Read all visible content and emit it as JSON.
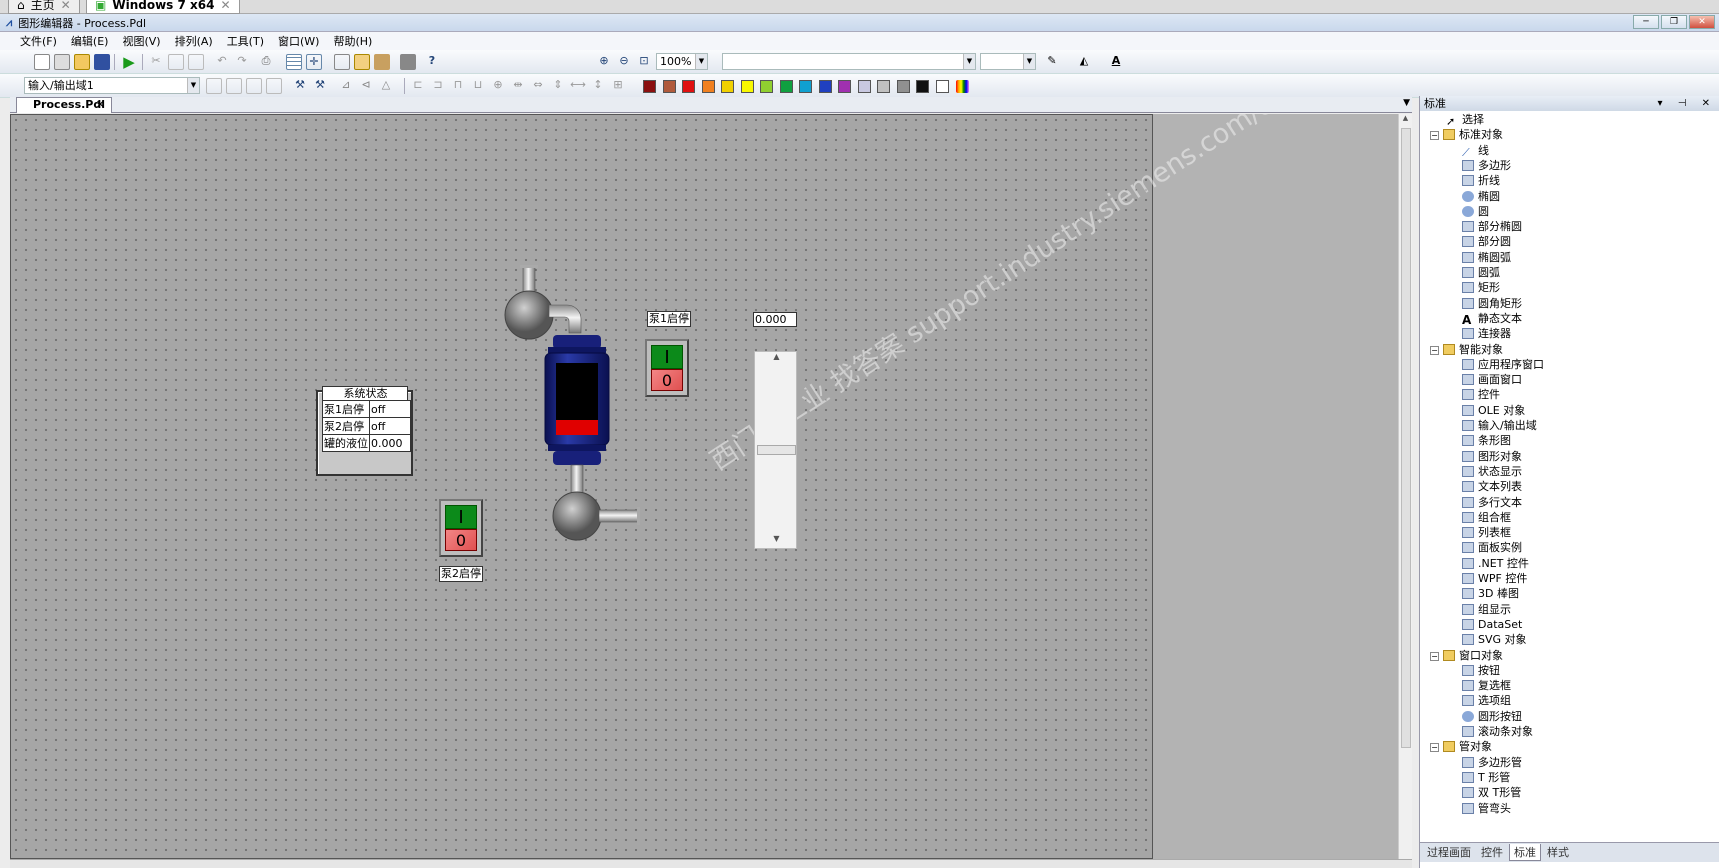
{
  "vm_tabs": [
    {
      "label": "主页"
    },
    {
      "label": "Windows 7 x64"
    }
  ],
  "window": {
    "title": "图形编辑器 - Process.Pdl"
  },
  "menu": [
    "文件(F)",
    "编辑(E)",
    "视图(V)",
    "排列(A)",
    "工具(T)",
    "窗口(W)",
    "帮助(H)"
  ],
  "toolbar": {
    "zoom": "100%",
    "object_select": "输入/输出域1"
  },
  "palette": [
    "#8b1010",
    "#b05a3c",
    "#e01010",
    "#f08020",
    "#f0d000",
    "#f8f800",
    "#90d030",
    "#10a040",
    "#10a0d0",
    "#2040c0",
    "#a030b0",
    "#c8c8e0",
    "#c0c0c0",
    "#909090",
    "#101010",
    "#ffffff"
  ],
  "document": {
    "tab": "Process.Pdl"
  },
  "canvas": {
    "status_table": {
      "title": "系统状态",
      "rows": [
        [
          "泵1启停",
          "off"
        ],
        [
          "泵2启停",
          "off"
        ],
        [
          "罐的液位",
          "0.000"
        ]
      ]
    },
    "pump1_label": "泵1启停",
    "pump2_label": "泵2启停",
    "level_value": "0.000",
    "button_on": "I",
    "button_off": "0",
    "watermark": "西门子工业  找答案  support.industry.siemens.com/cs"
  },
  "panel": {
    "title": "标准",
    "tree": [
      {
        "label": "选择",
        "depth": 1,
        "icon": "cursor"
      },
      {
        "label": "标准对象",
        "depth": 0,
        "icon": "folder",
        "group": true
      },
      {
        "label": "线",
        "depth": 2,
        "icon": "line"
      },
      {
        "label": "多边形",
        "depth": 2,
        "icon": "polygon"
      },
      {
        "label": "折线",
        "depth": 2,
        "icon": "polyline"
      },
      {
        "label": "椭圆",
        "depth": 2,
        "icon": "ellipse"
      },
      {
        "label": "圆",
        "depth": 2,
        "icon": "circle"
      },
      {
        "label": "部分椭圆",
        "depth": 2,
        "icon": "ellipse-segment"
      },
      {
        "label": "部分圆",
        "depth": 2,
        "icon": "pie"
      },
      {
        "label": "椭圆弧",
        "depth": 2,
        "icon": "ellipse-arc"
      },
      {
        "label": "圆弧",
        "depth": 2,
        "icon": "arc"
      },
      {
        "label": "矩形",
        "depth": 2,
        "icon": "rect"
      },
      {
        "label": "圆角矩形",
        "depth": 2,
        "icon": "round-rect"
      },
      {
        "label": "静态文本",
        "depth": 2,
        "icon": "text"
      },
      {
        "label": "连接器",
        "depth": 2,
        "icon": "connector"
      },
      {
        "label": "智能对象",
        "depth": 0,
        "icon": "folder",
        "group": true
      },
      {
        "label": "应用程序窗口",
        "depth": 2,
        "icon": "app-window"
      },
      {
        "label": "画面窗口",
        "depth": 2,
        "icon": "picture-window"
      },
      {
        "label": "控件",
        "depth": 2,
        "icon": "ocx"
      },
      {
        "label": "OLE 对象",
        "depth": 2,
        "icon": "ole"
      },
      {
        "label": "输入/输出域",
        "depth": 2,
        "icon": "io-field"
      },
      {
        "label": "条形图",
        "depth": 2,
        "icon": "bar"
      },
      {
        "label": "图形对象",
        "depth": 2,
        "icon": "graphic"
      },
      {
        "label": "状态显示",
        "depth": 2,
        "icon": "status"
      },
      {
        "label": "文本列表",
        "depth": 2,
        "icon": "textlist"
      },
      {
        "label": "多行文本",
        "depth": 2,
        "icon": "multiline"
      },
      {
        "label": "组合框",
        "depth": 2,
        "icon": "combobox"
      },
      {
        "label": "列表框",
        "depth": 2,
        "icon": "listbox"
      },
      {
        "label": "面板实例",
        "depth": 2,
        "icon": "faceplate"
      },
      {
        "label": ".NET 控件",
        "depth": 2,
        "icon": "dotnet"
      },
      {
        "label": "WPF 控件",
        "depth": 2,
        "icon": "wpf"
      },
      {
        "label": "3D 棒图",
        "depth": 2,
        "icon": "bar3d"
      },
      {
        "label": "组显示",
        "depth": 2,
        "icon": "group-display"
      },
      {
        "label": "DataSet",
        "depth": 2,
        "icon": "dataset"
      },
      {
        "label": "SVG 对象",
        "depth": 2,
        "icon": "svg"
      },
      {
        "label": "窗口对象",
        "depth": 0,
        "icon": "folder",
        "group": true
      },
      {
        "label": "按钮",
        "depth": 2,
        "icon": "button"
      },
      {
        "label": "复选框",
        "depth": 2,
        "icon": "checkbox"
      },
      {
        "label": "选项组",
        "depth": 2,
        "icon": "radio"
      },
      {
        "label": "圆形按钮",
        "depth": 2,
        "icon": "round-button"
      },
      {
        "label": "滚动条对象",
        "depth": 2,
        "icon": "scrollbar"
      },
      {
        "label": "管对象",
        "depth": 0,
        "icon": "folder",
        "group": true
      },
      {
        "label": "多边形管",
        "depth": 2,
        "icon": "pipe"
      },
      {
        "label": "T 形管",
        "depth": 2,
        "icon": "t-pipe"
      },
      {
        "label": "双 T形管",
        "depth": 2,
        "icon": "double-t-pipe"
      },
      {
        "label": "管弯头",
        "depth": 2,
        "icon": "elbow"
      }
    ],
    "tabs": [
      "过程画面",
      "控件",
      "标准",
      "样式"
    ]
  }
}
